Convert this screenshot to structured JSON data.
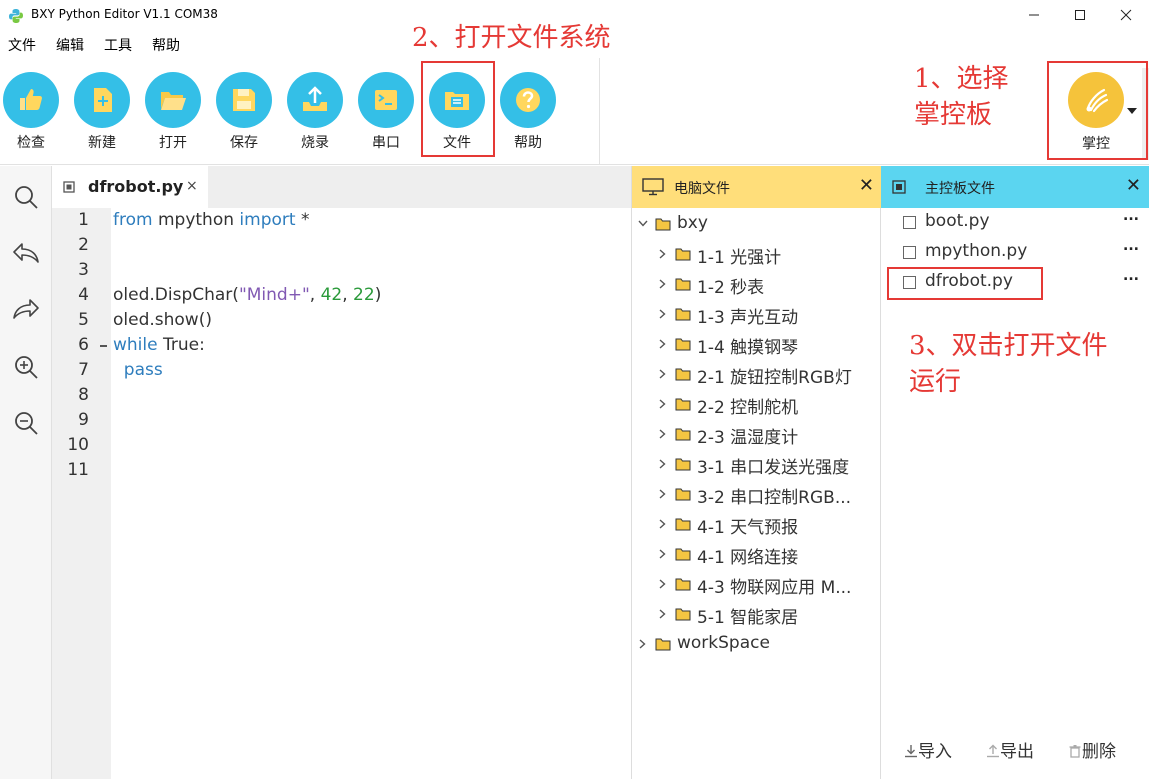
{
  "window": {
    "title": "BXY Python Editor V1.1 COM38"
  },
  "menu": [
    "文件",
    "编辑",
    "工具",
    "帮助"
  ],
  "toolbar": {
    "buttons": [
      {
        "label": "检查",
        "icon": "thumbs-up-icon"
      },
      {
        "label": "新建",
        "icon": "new-file-icon"
      },
      {
        "label": "打开",
        "icon": "open-folder-icon"
      },
      {
        "label": "保存",
        "icon": "save-icon"
      },
      {
        "label": "烧录",
        "icon": "upload-icon"
      },
      {
        "label": "串口",
        "icon": "terminal-icon"
      },
      {
        "label": "文件",
        "icon": "file-system-icon"
      },
      {
        "label": "帮助",
        "icon": "help-icon"
      }
    ],
    "board": {
      "label": "掌控",
      "icon": "mpython-board-icon"
    }
  },
  "annotations": {
    "step1": [
      "1、选择",
      "掌控板"
    ],
    "step2": "2、打开文件系统",
    "step3": [
      "3、双击打开文件",
      "运行"
    ]
  },
  "editor": {
    "tab": {
      "label": "dfrobot.py",
      "close": "×"
    },
    "line_numbers": [
      "1",
      "2",
      "3",
      "4",
      "5",
      "6",
      "7",
      "8",
      "9",
      "10",
      "11"
    ],
    "code": {
      "l1": {
        "kw1": "from",
        "mod": " mpython ",
        "kw2": "import",
        "rest": " *"
      },
      "l4": {
        "a": "oled.DispChar(",
        "s": "\"Mind+\"",
        "b": ", ",
        "n1": "42",
        "c": ", ",
        "n2": "22",
        "d": ")"
      },
      "l5": "oled.show()",
      "l6": {
        "kw": "while",
        "rest": " True:"
      },
      "l7": {
        "kw": "  pass"
      }
    }
  },
  "pc_files": {
    "title": "电脑文件",
    "close": "✕",
    "root": "bxy",
    "items": [
      "1-1 光强计",
      "1-2 秒表",
      "1-3 声光互动",
      "1-4 触摸钢琴",
      "2-1 旋钮控制RGB灯",
      "2-2 控制舵机",
      "2-3 温湿度计",
      "3-1 串口发送光强度",
      "3-2 串口控制RGB...",
      "4-1 天气预报",
      "4-1 网络连接",
      "4-3 物联网应用 M...",
      "5-1 智能家居"
    ],
    "workspace": "workSpace"
  },
  "board_files": {
    "title": "主控板文件",
    "close": "✕",
    "files": [
      "boot.py",
      "mpython.py",
      "dfrobot.py"
    ],
    "more": "...",
    "footer": {
      "import": "导入",
      "export": "导出",
      "delete": "删除"
    }
  }
}
